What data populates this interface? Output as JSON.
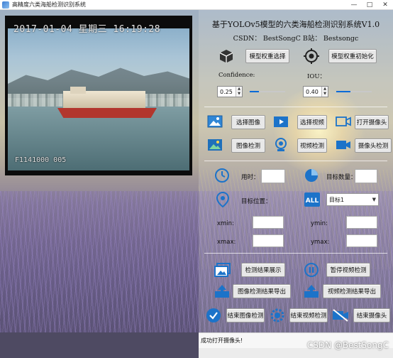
{
  "window": {
    "title": "高精度六类海船检测识别系统"
  },
  "video": {
    "timestamp": "2017-01-04  星期三  16:19:28",
    "bottom_text": "F1141000      005"
  },
  "header": {
    "title": "基于YOLOv5模型的六类海船检测识别系统V1.0",
    "subtitle": "CSDN：  BestSongC    B站：  Bestsongc"
  },
  "model": {
    "select_weights": "模型权重选择",
    "init_weights": "模型权重初始化"
  },
  "params": {
    "confidence_label": "Confidence:",
    "confidence_value": "0.25",
    "confidence_level": 0.25,
    "iou_label": "IOU：",
    "iou_value": "0.40",
    "iou_level": 0.4
  },
  "sources": {
    "select_image": "选择图像",
    "select_video": "选择视频",
    "open_camera": "打开摄像头",
    "image_detect": "图像检测",
    "video_detect": "视频检测",
    "camera_detect": "摄像头检测"
  },
  "results": {
    "time_label": "用时：",
    "count_label": "目标数量：",
    "position_label": "目标位置：",
    "target_select": "目标1",
    "xmin_label": "xmin:",
    "ymin_label": "ymin:",
    "xmax_label": "xmax:",
    "ymax_label": "ymax:"
  },
  "actions": {
    "show_results": "检测结果展示",
    "pause_video": "暂停视频检测",
    "export_image": "图像检测结果导出",
    "export_video": "视频检测结果导出",
    "end_image": "结束图像检测",
    "end_video": "结束视频检测",
    "end_camera": "结束摄像头"
  },
  "status": {
    "message": "成功打开摄像头!"
  },
  "watermark": "CSDN @BestSongC",
  "colors": {
    "accent": "#0a6ad8",
    "icon_blue": "#1c73c9"
  }
}
